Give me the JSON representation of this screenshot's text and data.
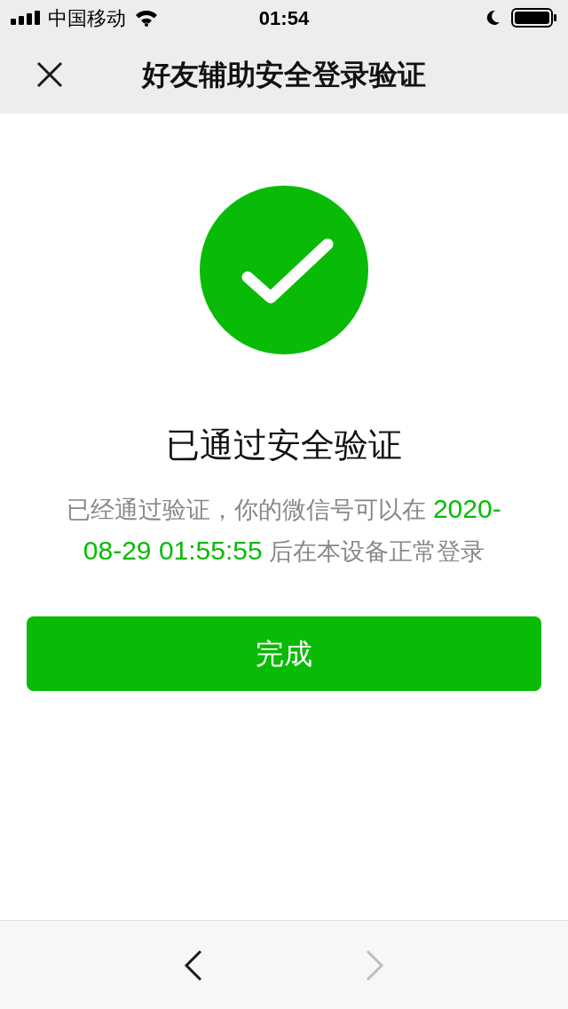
{
  "status_bar": {
    "carrier": "中国移动",
    "time": "01:54"
  },
  "header": {
    "title": "好友辅助安全登录验证"
  },
  "result": {
    "title": "已通过安全验证",
    "description": [
      {
        "text": "已经通过验证，你的微信号可以在 ",
        "highlight": false
      },
      {
        "text": "2020-08-29 01:55:55",
        "highlight": true
      },
      {
        "text": " 后在本设备正常登录",
        "highlight": false
      }
    ]
  },
  "button": "完成",
  "toolbar": {
    "back": {
      "disabled": false
    },
    "forward": {
      "disabled": true
    }
  }
}
